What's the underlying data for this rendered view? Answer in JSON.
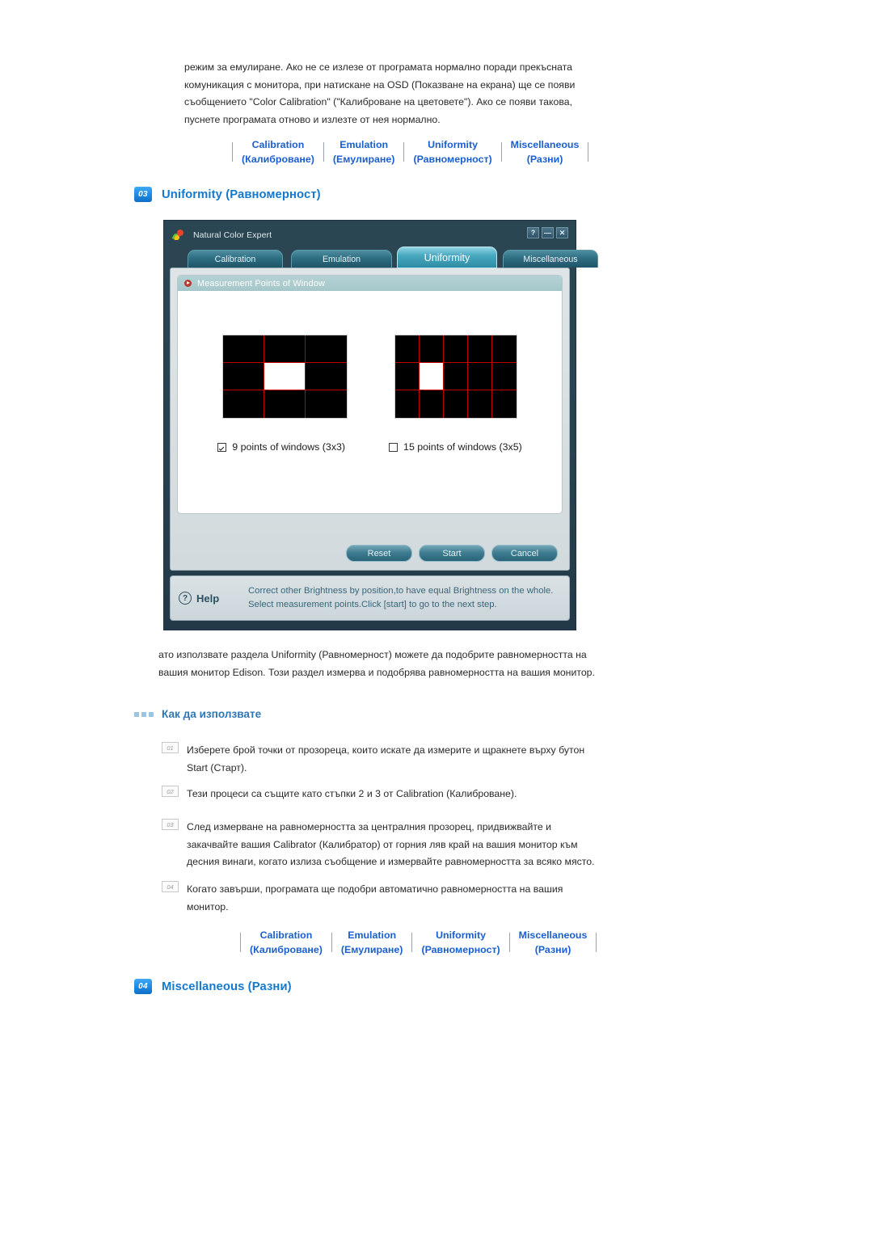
{
  "intro_paragraph": "режим за емулиране. Ако не се излезе от програмата нормално поради прекъсната комуникация с монитора, при натискане на OSD (Показване на екрана) ще се появи съобщението \"Color Calibration\" (\"Калиброване на цветовете\"). Ако се появи такова, пуснете програмата отново и излезте от нея нормално.",
  "nav": {
    "items": [
      {
        "en": "Calibration",
        "bg": "(Калиброване)"
      },
      {
        "en": "Emulation",
        "bg": "(Емулиране)"
      },
      {
        "en": "Uniformity",
        "bg": "(Равномерност)"
      },
      {
        "en": "Miscellaneous",
        "bg": "(Разни)"
      }
    ]
  },
  "section_uniformity": {
    "number": "03",
    "title": "Uniformity (Равномерност)"
  },
  "section_miscellaneous": {
    "number": "04",
    "title": "Miscellaneous (Разни)"
  },
  "app": {
    "title": "Natural Color Expert",
    "window_buttons": {
      "help": "?",
      "minimize": "—",
      "close": "✕"
    },
    "tabs": [
      {
        "label": "Calibration",
        "active": false
      },
      {
        "label": "Emulation",
        "active": false
      },
      {
        "label": "Uniformity",
        "active": true
      },
      {
        "label": "Miscellaneous",
        "active": false
      }
    ],
    "group_title": "Measurement Points of Window",
    "options": [
      {
        "label": "9 points of windows (3x3)",
        "checked": true,
        "cols": 3,
        "rows": 3
      },
      {
        "label": "15 points of windows (3x5)",
        "checked": false,
        "cols": 5,
        "rows": 3
      }
    ],
    "buttons": [
      {
        "label": "Reset"
      },
      {
        "label": "Start"
      },
      {
        "label": "Cancel"
      }
    ],
    "help": {
      "label": "Help",
      "text": "Correct other Brightness by position,to have equal Brightness on the whole. Select measurement points.Click [start] to go to the next step."
    },
    "colors": {
      "window_bg": "#2b4653",
      "tab_active": "#49a9c0",
      "grid_line": "#c00000",
      "grid_bg": "#000000",
      "lit_cell": "#ffffff"
    }
  },
  "body_paragraph": "ато използвате раздела Uniformity (Равномерност) можете да подобрите равномерността на вашия монитор Edison. Този раздел измерва и подобрява равномерността на вашия монитор.",
  "howto": {
    "title": "Как да използвате",
    "steps": [
      {
        "num": "01",
        "text": "Изберете брой точки от прозореца, които искате да измерите и щракнете върху бутон Start (Старт)."
      },
      {
        "num": "02",
        "text": "Тези процеси са същите като стъпки 2 и 3 от Calibration (Калиброване)."
      },
      {
        "num": "03",
        "text": "След измерване на равномерността за централния прозорец, придвижвайте и закачвайте вашия Calibrator (Калибратор) от горния ляв край на вашия монитор към десния винаги, когато излиза съобщение и измервайте равномерността за всяко място."
      },
      {
        "num": "04",
        "text": "Когато завърши, програмата ще подобри автоматично равномерността на вашия монитор."
      }
    ]
  }
}
